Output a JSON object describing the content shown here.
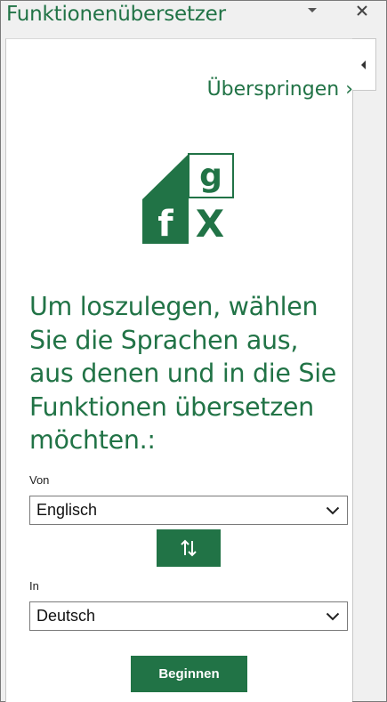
{
  "pane": {
    "title": "Funktionenübersetzer",
    "skip_link": "Überspringen ›",
    "intro": "Um loszulegen, wählen Sie die Sprachen aus, aus denen und in die Sie Funktionen übersetzen möchten.:"
  },
  "logo": {
    "letters": [
      "g",
      "f",
      "X"
    ]
  },
  "from_field": {
    "label": "Von",
    "value": "Englisch"
  },
  "to_field": {
    "label": "In",
    "value": "Deutsch"
  },
  "buttons": {
    "start_label": "Beginnen"
  },
  "colors": {
    "accent": "#217346",
    "pane_background": "#f0f0f0"
  },
  "icons": [
    "pin-icon",
    "close-icon",
    "collapse-arrow-icon",
    "swap-icon",
    "chevron-down-icon"
  ]
}
